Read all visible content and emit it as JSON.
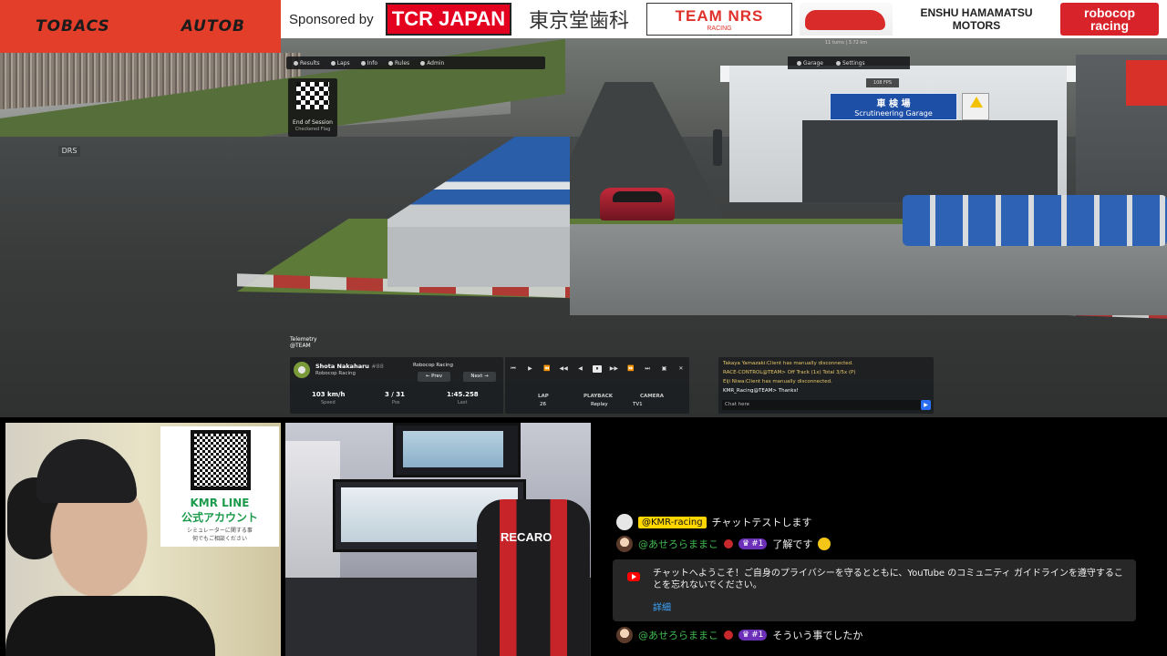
{
  "sponsors": {
    "label": "Sponsored by",
    "autobacs_left": "TOBACS",
    "autobacs_right": "AUTOB",
    "tcr": "TCR JAPAN",
    "tokyodo": "東京堂歯科",
    "nrs_main": "TEAM NRS",
    "nrs_sub": "RACING",
    "enshu_line1": "ENSHU HAMAMATSU",
    "enshu_line2": "MOTORS",
    "robocop_line1": "robocop",
    "robocop_line2": "racing"
  },
  "hud": {
    "tabs": [
      "Results",
      "Laps",
      "Info",
      "Rules",
      "Admin"
    ],
    "right_tabs": [
      "Garage",
      "Settings"
    ],
    "fps": "108 FPS",
    "stat": "11 turns  |  3.72 km",
    "flag_title": "End of Session",
    "flag_sub": "Checkered Flag",
    "drs": "DRS"
  },
  "scenery": {
    "garage_sign_jp": "車 検 場",
    "garage_sign_en": "Scrutineering Garage"
  },
  "telemetry": {
    "title": "Telemetry",
    "team_tag": "@TEAM"
  },
  "driver": {
    "name": "Shota Nakaharu",
    "number": "#88",
    "team": "Robocop Racing",
    "team_right": "Robocop Racing",
    "prev": "← Prev",
    "next": "Next →",
    "speed_value": "103 km/h",
    "speed_label": "Speed",
    "pos_value": "3 / 31",
    "pos_label": "Pos",
    "last_value": "1:45.258",
    "last_label": "Last"
  },
  "playback": {
    "controls": [
      "⏮",
      "▶",
      "⏪",
      "◀◀",
      "◀",
      "⏸",
      "▶▶",
      "⏩",
      "⏭",
      "▣",
      "✕"
    ],
    "lap_label": "LAP",
    "lap_value": "26",
    "playback_label": "PLAYBACK",
    "playback_value": "Replay",
    "camera_label": "CAMERA",
    "camera_value": "TV1"
  },
  "game_chat": {
    "messages": [
      {
        "text": "Takaya Yamazaki:Client has manually disconnected.",
        "color": "#e8c86a"
      },
      {
        "text": "RACE-CONTROL@TEAM> Off Track (1x) Total 3/5x (P)",
        "color": "#e8c86a"
      },
      {
        "text": "Eiji Niwa:Client has manually disconnected.",
        "color": "#e8c86a"
      },
      {
        "text": "KMR_Racing@TEAM> Thanks!",
        "color": "#ffffff"
      }
    ],
    "placeholder": "Chat here"
  },
  "cam_overlay": {
    "qr_title_1": "KMR LINE",
    "qr_title_2": "公式アカウント",
    "qr_desc_1": "シミュレーターに関する事",
    "qr_desc_2": "何でもご相談ください",
    "seat_logo": "RECARO"
  },
  "youtube_chat": {
    "msg1_author": "@KMR-racing",
    "msg1_text": "チャットテストします",
    "msg2_author": "@あせろらままこ",
    "msg2_badge": "#1",
    "msg2_text": "了解です",
    "notice_text": "チャットへようこそ！ご自身のプライバシーを守るとともに、YouTube のコミュニティ ガイドラインを遵守することを忘れないでください。",
    "notice_link": "詳細",
    "msg3_author": "@あせろらままこ",
    "msg3_badge": "#1",
    "msg3_text": "そういう事でしたか"
  }
}
